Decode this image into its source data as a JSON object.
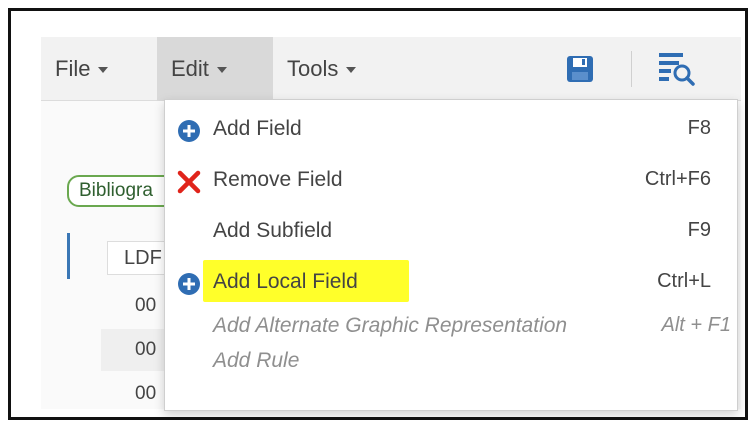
{
  "menubar": {
    "file_label": "File",
    "edit_label": "Edit",
    "tools_label": "Tools",
    "icons": [
      "save-icon",
      "search-records-icon"
    ]
  },
  "background": {
    "biblio_label": "Bibliogra",
    "ldr_label": "LDF",
    "rows": [
      "00",
      "00",
      "00"
    ]
  },
  "edit_menu": {
    "items": [
      {
        "label": "Add Field",
        "shortcut": "F8",
        "icon": "plus-circle-icon",
        "enabled": true
      },
      {
        "label": "Remove Field",
        "shortcut": "Ctrl+F6",
        "icon": "x-icon",
        "enabled": true
      },
      {
        "label": "Add Subfield",
        "shortcut": "F9",
        "icon": "",
        "enabled": true
      },
      {
        "label": "Add Local Field",
        "shortcut": "Ctrl+L",
        "icon": "plus-circle-icon",
        "enabled": true,
        "highlighted": true
      },
      {
        "label": "Add Alternate Graphic Representation",
        "shortcut": "Alt + F1",
        "icon": "",
        "enabled": false
      },
      {
        "label": "Add Rule",
        "shortcut": "",
        "icon": "",
        "enabled": false
      }
    ]
  },
  "colors": {
    "accent_blue": "#2f6db3",
    "remove_red": "#e0241b",
    "highlight_yellow": "#ffff2a",
    "menu_active_bg": "#d9d9d9"
  }
}
